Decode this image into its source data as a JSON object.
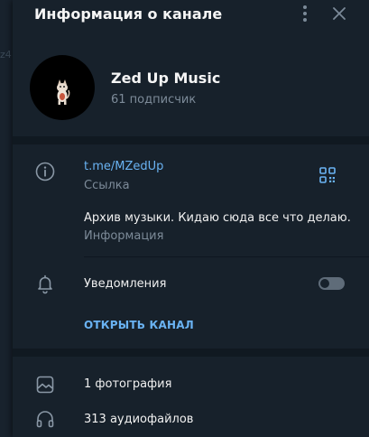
{
  "background": {
    "strip_text": "z4"
  },
  "header": {
    "title": "Информация о канале",
    "menu_icon": "vertical-dots-icon",
    "close_icon": "close-icon"
  },
  "channel": {
    "name": "Zed Up Music",
    "subscribers": "61 подписчик",
    "avatar_icon": "cat-icon"
  },
  "info": {
    "link": "t.me/MZedUp",
    "link_label": "Ссылка",
    "qr_icon": "qr-code-icon",
    "description": "Архив музыки. Кидаю сюда все что делаю.",
    "description_label": "Информация"
  },
  "notifications": {
    "label": "Уведомления",
    "enabled": false
  },
  "actions": {
    "open_channel": "ОТКРЫТЬ КАНАЛ"
  },
  "media": [
    {
      "icon": "image-icon",
      "label": "1 фотография"
    },
    {
      "icon": "headphones-icon",
      "label": "313 аудиофайлов"
    }
  ],
  "colors": {
    "accent": "#6ab3f3",
    "panel": "#17212b",
    "separator": "#101921",
    "muted": "#7d8b99"
  }
}
